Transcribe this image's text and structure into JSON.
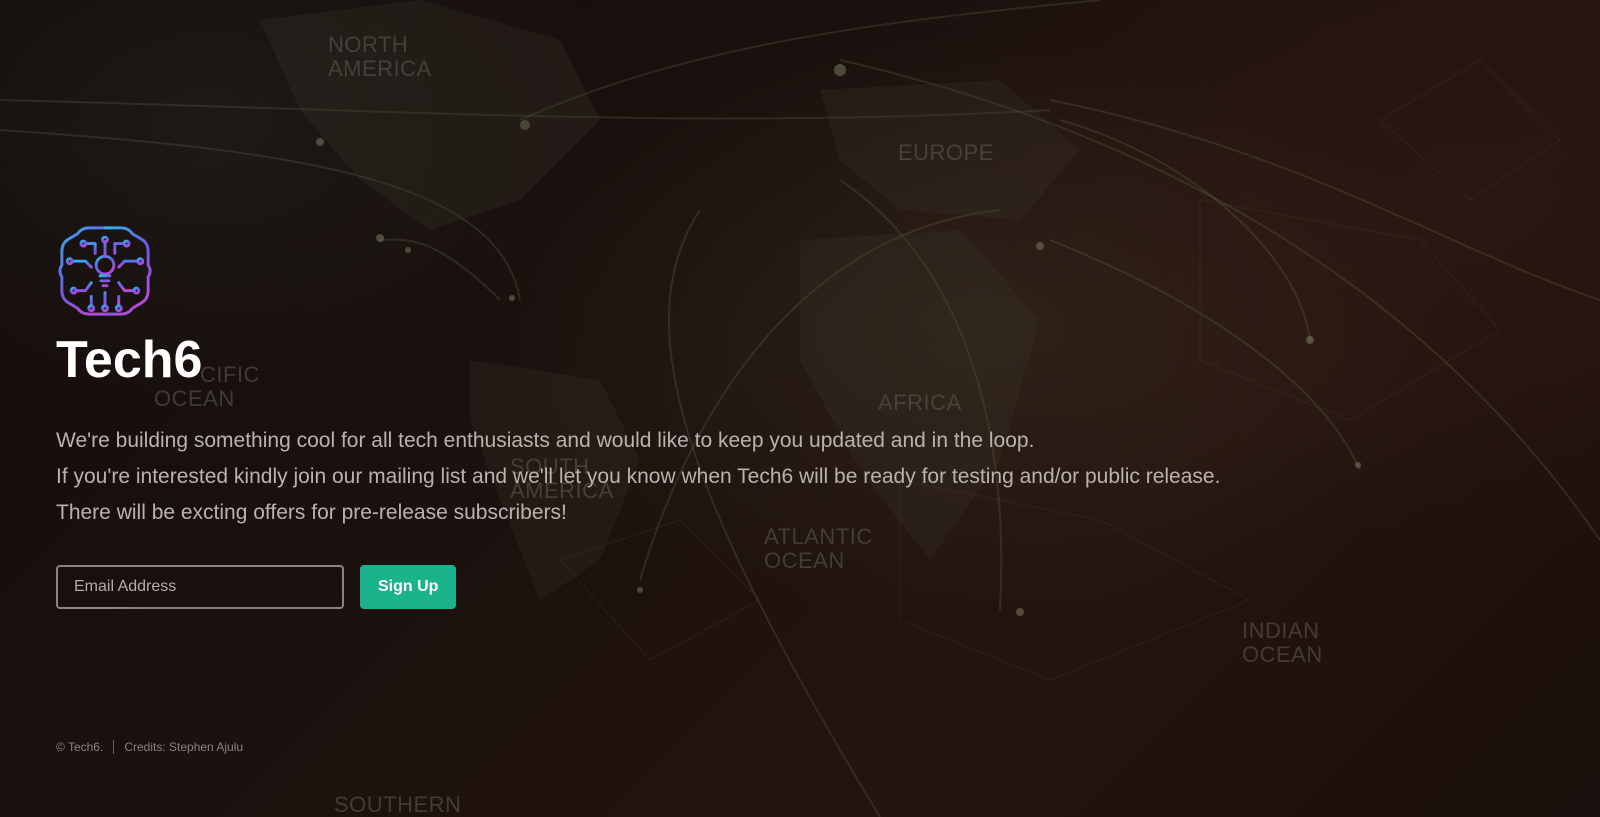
{
  "brand": {
    "name": "Tech6",
    "logo_icon": "brain-circuit-icon",
    "logo_colors": [
      "#3aa6e8",
      "#7b4fe0",
      "#b04ad8"
    ]
  },
  "intro": {
    "line1": "We're building something cool for all tech enthusiasts and would like to keep you updated and in the loop.",
    "line2": "If you're interested kindly join our mailing list and we'll let you know when Tech6 will be ready for testing and/or public release.",
    "line3": "There will be excting offers for pre-release subscribers!"
  },
  "signup": {
    "email_placeholder": "Email Address",
    "email_value": "",
    "button_label": "Sign Up",
    "button_color": "#1bb38c"
  },
  "footer": {
    "copyright": "© Tech6.",
    "credits": "Credits: Stephen Ajulu"
  },
  "background_map": {
    "labels": [
      "NORTH",
      "AMERICA",
      "EUROPE",
      "AFRICA",
      "CIFIC",
      "OCEAN",
      "SOUTH",
      "AMERICA",
      "ATLANTIC",
      "OCEAN",
      "INDIAN",
      "OCEAN",
      "SOUTHERN"
    ]
  }
}
